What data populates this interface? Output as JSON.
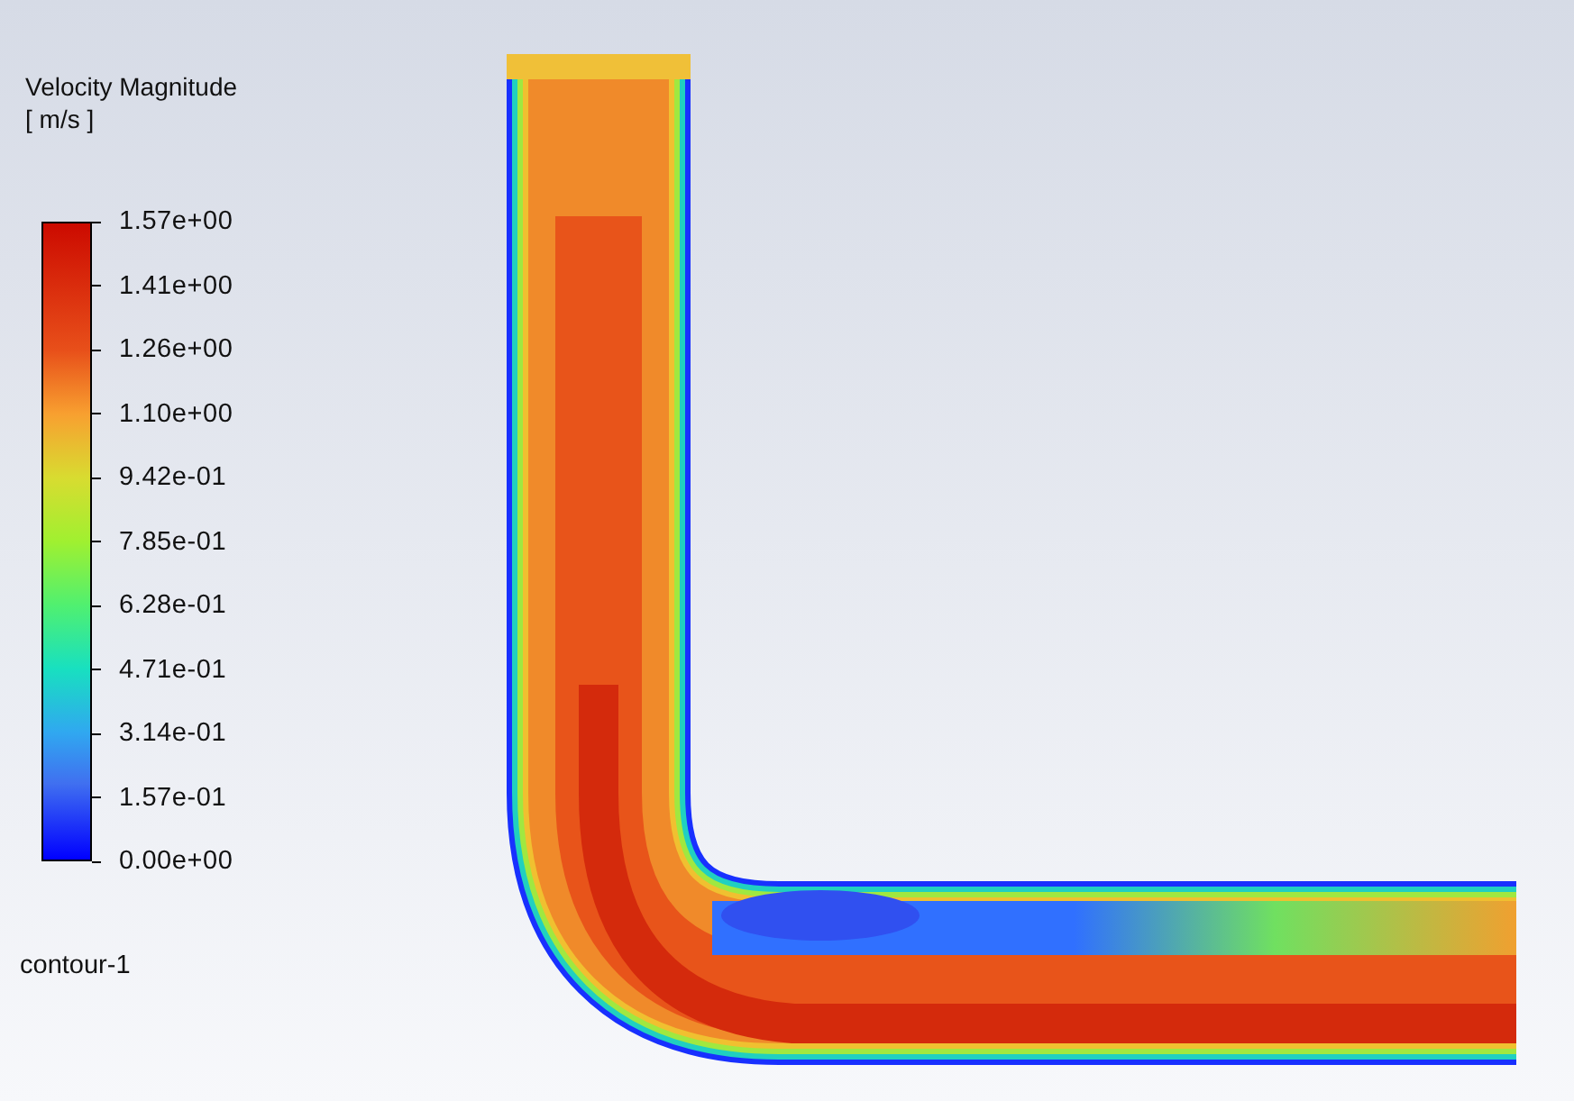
{
  "legend": {
    "title": "Velocity Magnitude",
    "unit": "[ m/s ]",
    "ticks": [
      "1.57e+00",
      "1.41e+00",
      "1.26e+00",
      "1.10e+00",
      "9.42e-01",
      "7.85e-01",
      "6.28e-01",
      "4.71e-01",
      "3.14e-01",
      "1.57e-01",
      "0.00e+00"
    ]
  },
  "contour_name": "contour-1"
}
